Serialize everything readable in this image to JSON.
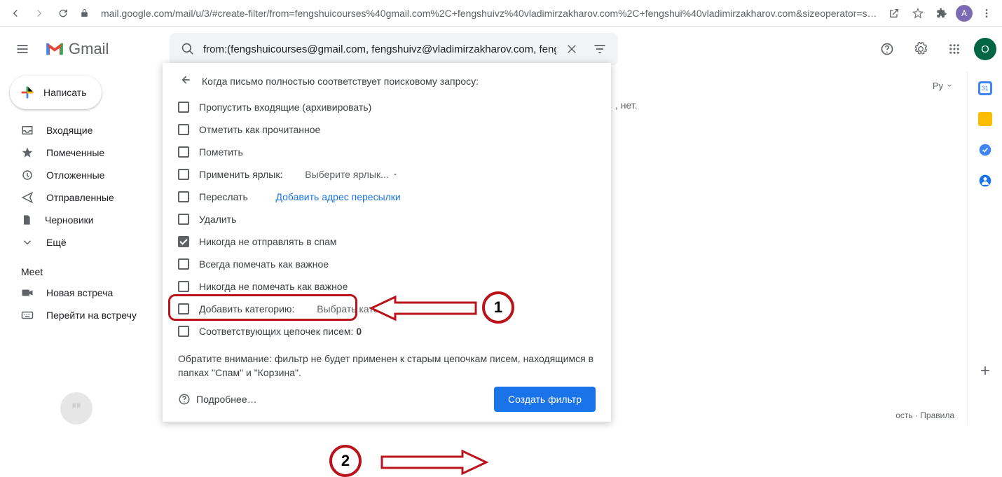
{
  "browser": {
    "url": "mail.google.com/mail/u/3/#create-filter/from=fengshuicourses%40gmail.com%2C+fengshuivz%40vladimirzakharov.com%2C+fengshui%40vladimirzakharov.com&sizeoperator=s_sl&sizeunit=s_smb",
    "avatar": "A"
  },
  "header": {
    "brand": "Gmail",
    "search_value": "from:(fengshuicourses@gmail.com, fengshuivz@vladimirzakharov.com, fengshu",
    "avatar": "O"
  },
  "sidebar": {
    "compose": "Написать",
    "items": [
      "Входящие",
      "Помеченные",
      "Отложенные",
      "Отправленные",
      "Черновики",
      "Ещё"
    ],
    "meet_header": "Meet",
    "meet_items": [
      "Новая встреча",
      "Перейти на встречу"
    ]
  },
  "toolbar": {
    "lang": "Ру"
  },
  "background": {
    "snippet": ", нет.",
    "footer": "ость · Правила"
  },
  "popup": {
    "title": "Когда письмо полностью соответствует поисковому запросу:",
    "options": {
      "archive": "Пропустить входящие (архивировать)",
      "mark_read": "Отметить как прочитанное",
      "star": "Пометить",
      "label": "Применить ярлык:",
      "label_select": "Выберите ярлык...",
      "forward": "Переслать",
      "forward_link": "Добавить адрес пересылки",
      "delete": "Удалить",
      "never_spam": "Никогда не отправлять в спам",
      "always_important": "Всегда помечать как важное",
      "never_important": "Никогда не помечать как важное",
      "category": "Добавить категорию:",
      "category_select": "Выбрать категорию...",
      "matching_prefix": "Соответствующих цепочек писем: ",
      "matching_count": "0"
    },
    "note": "Обратите внимание: фильтр не будет применен к старым цепочкам писем, находящимся в папках \"Спам\" и \"Корзина\".",
    "learn_more": "Подробнее…",
    "create": "Создать фильтр"
  },
  "annotations": {
    "num1": "1",
    "num2": "2"
  }
}
